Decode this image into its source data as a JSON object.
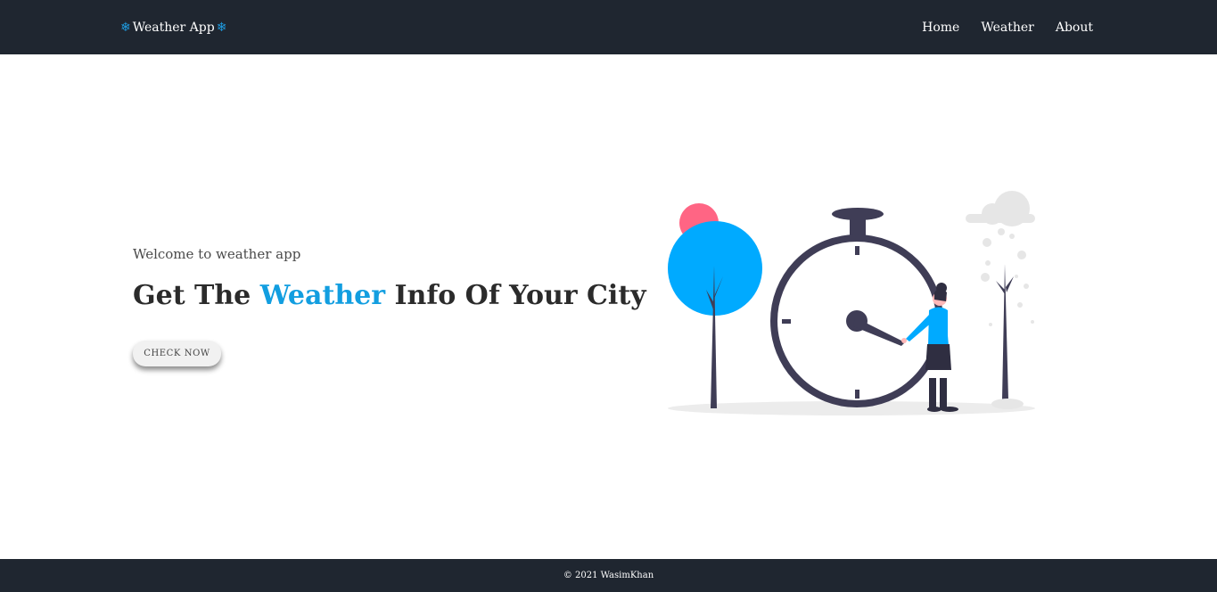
{
  "navbar": {
    "brand_label": "Weather App",
    "brand_icon": "snowflake-icon",
    "links": [
      {
        "label": "Home"
      },
      {
        "label": "Weather"
      },
      {
        "label": "About"
      }
    ]
  },
  "hero": {
    "welcome": "Welcome to weather app",
    "headline_before": "Get The ",
    "headline_accent": "Weather",
    "headline_after": " Info Of Your City",
    "cta_label": "CHECK NOW"
  },
  "footer": {
    "copyright": "© 2021 WasimKhan"
  },
  "colors": {
    "navbar_bg": "#1f2630",
    "accent": "#129ee0",
    "illustration_blue": "#00aaff",
    "illustration_pink": "#ff6584",
    "illustration_dark": "#3f3d56"
  }
}
